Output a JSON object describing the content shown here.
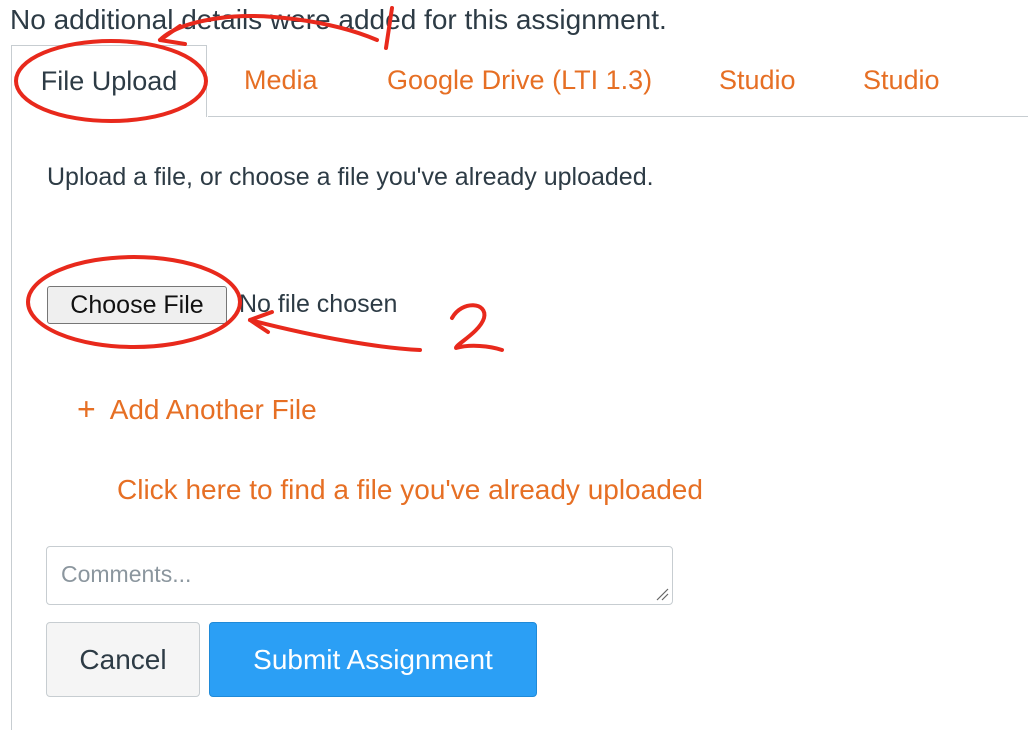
{
  "intro_text": "No additional details were added for this assignment.",
  "tabs": [
    {
      "label": "File Upload",
      "active": true
    },
    {
      "label": "Media"
    },
    {
      "label": "Google Drive (LTI 1.3)"
    },
    {
      "label": "Studio"
    },
    {
      "label": "Studio"
    }
  ],
  "upload": {
    "instructions": "Upload a file, or choose a file you've already uploaded.",
    "choose_label": "Choose File",
    "status": "No file chosen",
    "add_another": "Add Another File",
    "find_uploaded": "Click here to find a file you've already uploaded"
  },
  "comments": {
    "value": "",
    "placeholder": "Comments..."
  },
  "actions": {
    "cancel": "Cancel",
    "submit": "Submit Assignment"
  },
  "annotation_mark": "2",
  "colors": {
    "link": "#e66f24",
    "primary": "#2b9ff5",
    "annotation": "#e8291c"
  }
}
